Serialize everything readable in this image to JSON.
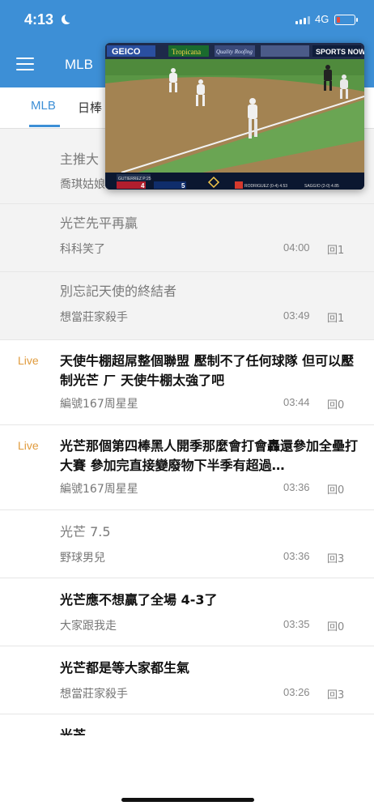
{
  "status": {
    "time": "4:13",
    "network": "4G"
  },
  "header": {
    "title": "MLB"
  },
  "tabs": [
    {
      "label": "MLB",
      "active": true
    },
    {
      "label": "日棒",
      "active": false
    }
  ],
  "colors": {
    "accent": "#3d8fd6",
    "live": "#e09b3d"
  },
  "video": {
    "broadcaster": "GEICO",
    "sponsor1": "Tropicana",
    "sponsor2": "Quality Roofing",
    "network_logo": "SPORTS NOW",
    "score_away": "4",
    "score_home": "5",
    "batter_left": "GUTIERREZ P:25",
    "batter_right": "RODRIGUEZ (0-4) 4.53",
    "pitcher_right": "SAGGIO (2-0) 4.85"
  },
  "posts": [
    {
      "title": "主推大",
      "author": "喬琪姑娘",
      "time": "",
      "replies": "",
      "live": false,
      "read": true
    },
    {
      "title": "光芒先平再贏",
      "author": "科科笑了",
      "time": "04:00",
      "replies": "回1",
      "live": false,
      "read": true
    },
    {
      "title": "別忘記天使的終結者",
      "author": "想當莊家殺手",
      "time": "03:49",
      "replies": "回1",
      "live": false,
      "read": true
    },
    {
      "title": "天使牛棚超屌整個聯盟 壓制不了任何球隊 但可以壓制光芒 ㄏ 天使牛棚太強了吧",
      "author": "編號167周星星",
      "time": "03:44",
      "replies": "回0",
      "live": true,
      "live_label": "Live",
      "read": false
    },
    {
      "title": "光芒那個第四棒黑人開季那麼會打會轟還參加全壘打大賽 參加完直接變廢物下半季有超過…",
      "author": "編號167周星星",
      "time": "03:36",
      "replies": "回0",
      "live": true,
      "live_label": "Live",
      "read": false
    },
    {
      "title": "光芒 7.5",
      "author": "野球男兒",
      "time": "03:36",
      "replies": "回3",
      "live": false,
      "read": true
    },
    {
      "title": "光芒應不想贏了全場 4-3了",
      "author": "大家跟我走",
      "time": "03:35",
      "replies": "回0",
      "live": false,
      "read": false
    },
    {
      "title": "光芒都是等大家都生氣",
      "author": "想當莊家殺手",
      "time": "03:26",
      "replies": "回3",
      "live": false,
      "read": false
    },
    {
      "title": "光芒",
      "author": "",
      "time": "",
      "replies": "",
      "live": false,
      "read": false
    }
  ]
}
